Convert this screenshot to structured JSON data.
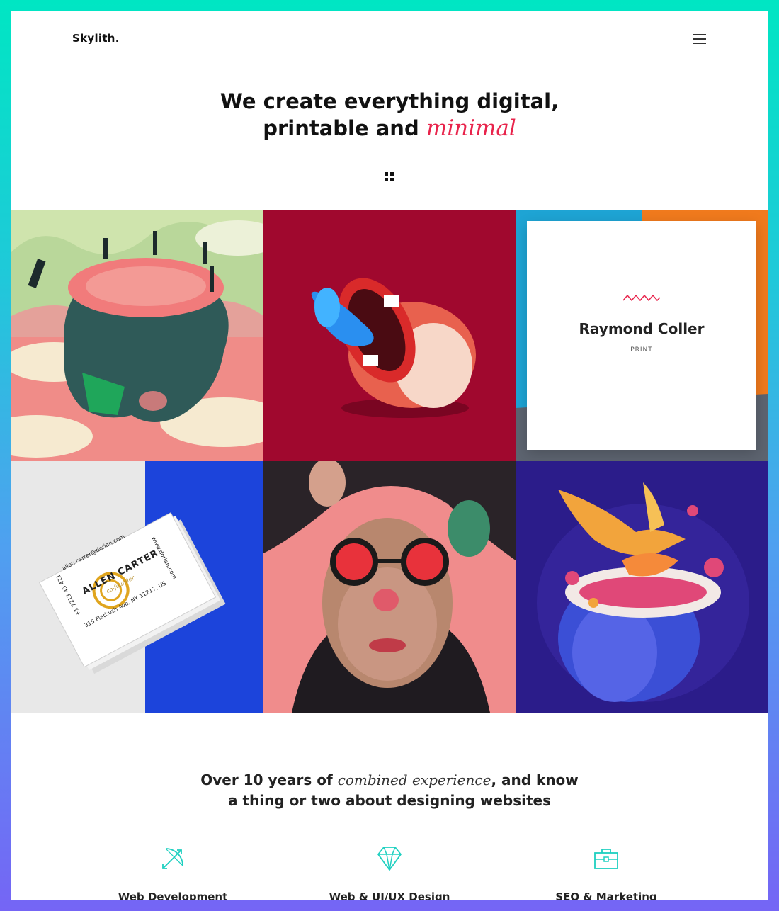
{
  "header": {
    "logo": "Skylith.",
    "menu_icon": "hamburger-menu-icon"
  },
  "hero": {
    "line1": "We create everything digital,",
    "line2_prefix": "printable and ",
    "line2_accent": "minimal",
    "filter_icon": "grid-icon"
  },
  "portfolio": {
    "featured": {
      "name": "Raymond Coller",
      "category": "PRINT"
    },
    "business_card": {
      "email": "allen.carter@dorian.com",
      "website": "www.dorian.com",
      "name": "ALLEN CARTER",
      "title": "co-founder",
      "address": "315 Flatbush Ave, NY 11217, US",
      "phone": "+1 7213 45 421"
    }
  },
  "about": {
    "prefix": "Over 10 years of ",
    "accent": "combined experience",
    "suffix": ", and know",
    "line2": "a thing or two about designing websites"
  },
  "services": [
    {
      "label": "Web Development",
      "icon": "bow-arrow-icon"
    },
    {
      "label": "Web & UI/UX Design",
      "icon": "diamond-icon"
    },
    {
      "label": "SEO & Marketing",
      "icon": "briefcase-icon"
    }
  ],
  "colors": {
    "accent": "#e8234b",
    "icon": "#1ed0c0",
    "border_top": "#00e6c3",
    "border_bottom": "#7565f5"
  }
}
